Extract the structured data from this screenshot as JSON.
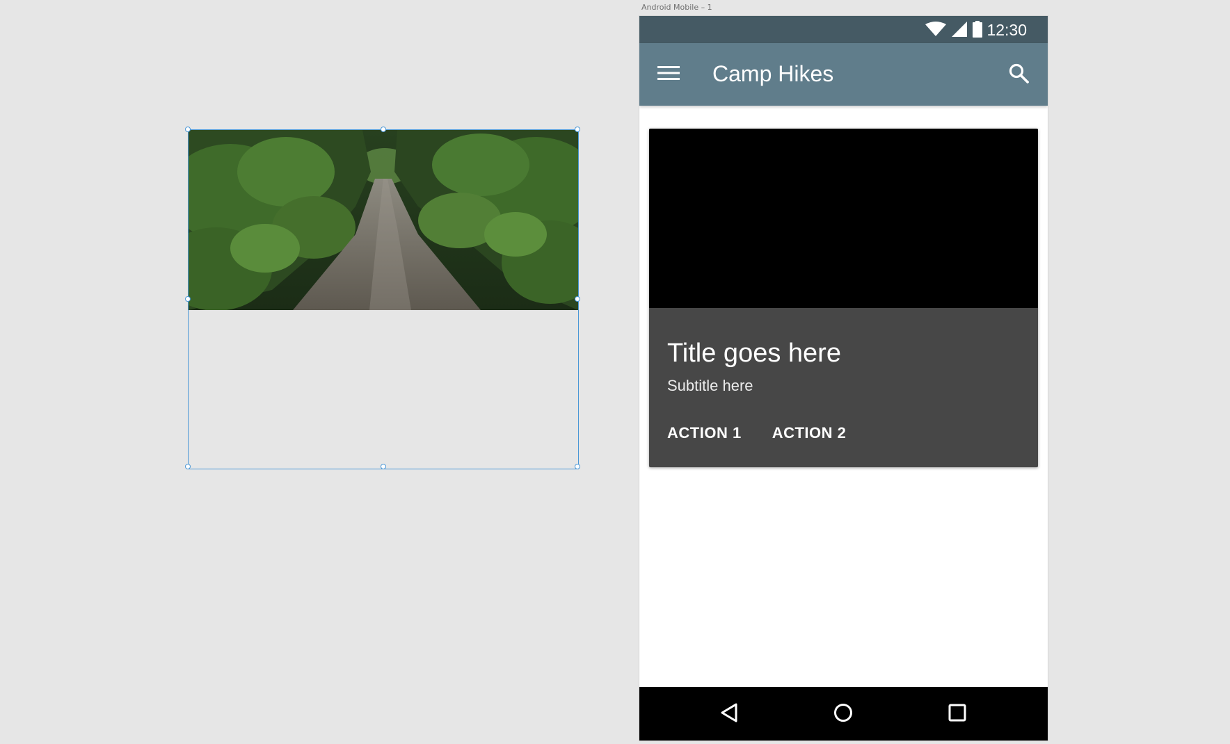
{
  "canvas": {
    "artboard_label": "Android Mobile – 1",
    "background_color": "#e6e6e6",
    "selection_color": "#4a97d6"
  },
  "status_bar": {
    "time": "12:30",
    "icons": [
      "wifi-icon",
      "cell-signal-icon",
      "battery-icon"
    ],
    "color": "#455a64"
  },
  "app_bar": {
    "title": "Camp Hikes",
    "menu_icon": "hamburger-menu-icon",
    "search_icon": "search-icon",
    "color": "#607d8b"
  },
  "card": {
    "title": "Title goes here",
    "subtitle": "Subtitle here",
    "actions": [
      {
        "label": "ACTION 1"
      },
      {
        "label": "ACTION 2"
      }
    ],
    "background_color": "#474747",
    "media_color": "#000000"
  },
  "nav_bar": {
    "icons": [
      "back-triangle-icon",
      "home-circle-icon",
      "recents-square-icon"
    ],
    "color": "#000000"
  }
}
